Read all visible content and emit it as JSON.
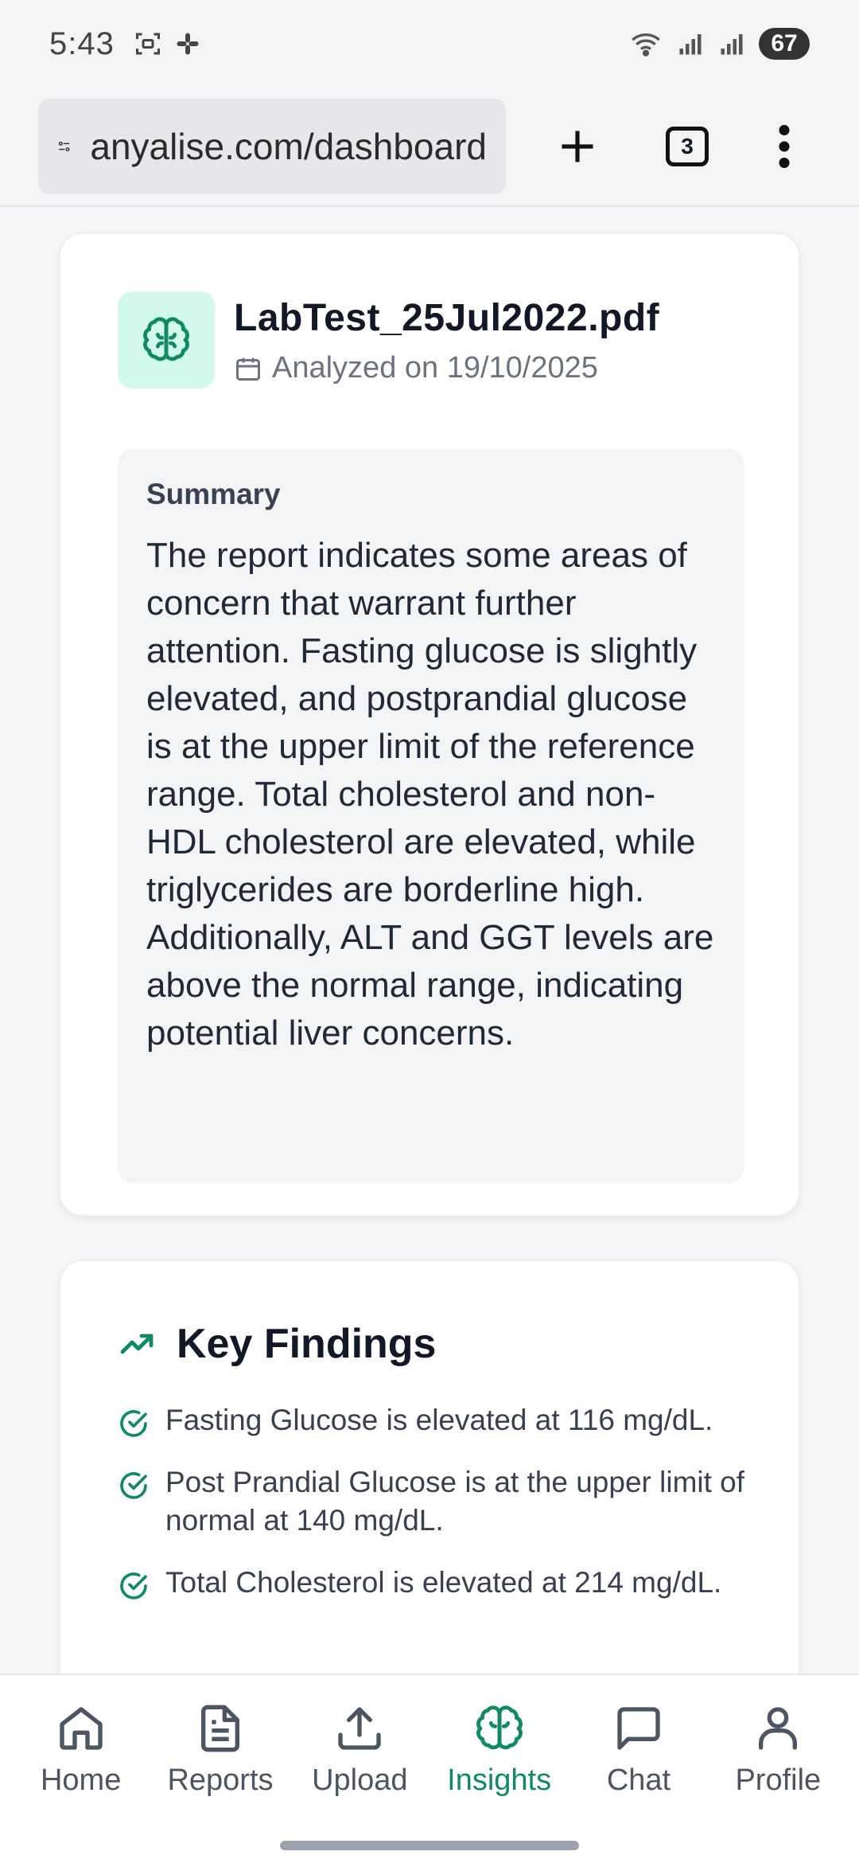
{
  "status_bar": {
    "time": "5:43",
    "battery": "67"
  },
  "browser": {
    "url": "anyalise.com/dashboard",
    "tab_count": "3"
  },
  "report": {
    "filename": "LabTest_25Jul2022.pdf",
    "analyzed": "Analyzed on 19/10/2025",
    "summary_label": "Summary",
    "summary_text": "The report indicates some areas of concern that warrant further attention. Fasting glucose is slightly elevated, and postprandial glucose is at the upper limit of the reference range. Total cholesterol and non-HDL cholesterol are elevated, while triglycerides are borderline high. Additionally, ALT and GGT levels are above the normal range, indicating potential liver concerns."
  },
  "findings": {
    "title": "Key Findings",
    "items": [
      "Fasting Glucose is elevated at 116 mg/dL.",
      "Post Prandial Glucose is at the upper limit of normal at 140 mg/dL.",
      "Total Cholesterol is elevated at 214 mg/dL."
    ]
  },
  "nav": {
    "home": "Home",
    "reports": "Reports",
    "upload": "Upload",
    "insights": "Insights",
    "chat": "Chat",
    "profile": "Profile",
    "active": "insights"
  },
  "colors": {
    "accent": "#0f8a64",
    "accent_bg": "#d1faec"
  }
}
